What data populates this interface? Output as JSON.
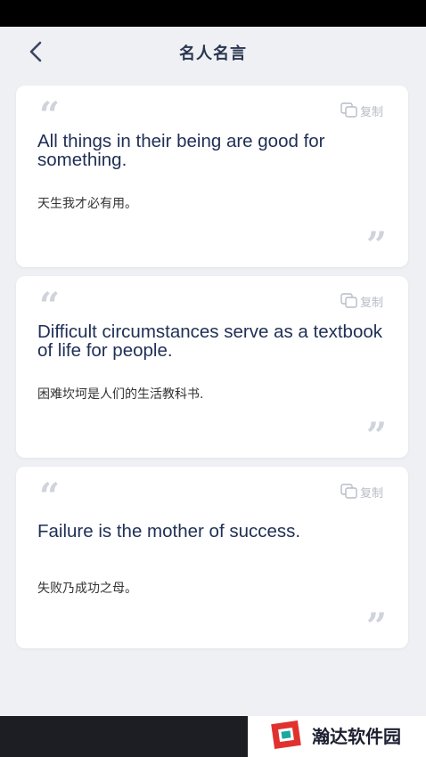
{
  "nav": {
    "title": "名人名言"
  },
  "copy_label": "复制",
  "quotes": [
    {
      "en": "All things in their being are good for something.",
      "zh": "天生我才必有用。"
    },
    {
      "en": "Difficult circumstances serve as a textbook of life for people.",
      "zh": "困难坎坷是人们的生活教科书."
    },
    {
      "en": "Failure is the mother of success.",
      "zh": "失败乃成功之母。"
    }
  ],
  "quote_marks": {
    "open": "“",
    "close": "”"
  },
  "watermark": {
    "text": "瀚达软件园"
  },
  "colors": {
    "background": "#eef0f4",
    "card": "#ffffff",
    "text_primary": "#1f2f55",
    "muted": "#b7bcc6",
    "quote_mark": "#cfd3dc",
    "watermark_red": "#e0312f",
    "watermark_teal": "#1aa9a0"
  },
  "icons": {
    "back": "chevron-left-icon",
    "copy": "copy-icon",
    "logo": "handa-logo-icon"
  }
}
